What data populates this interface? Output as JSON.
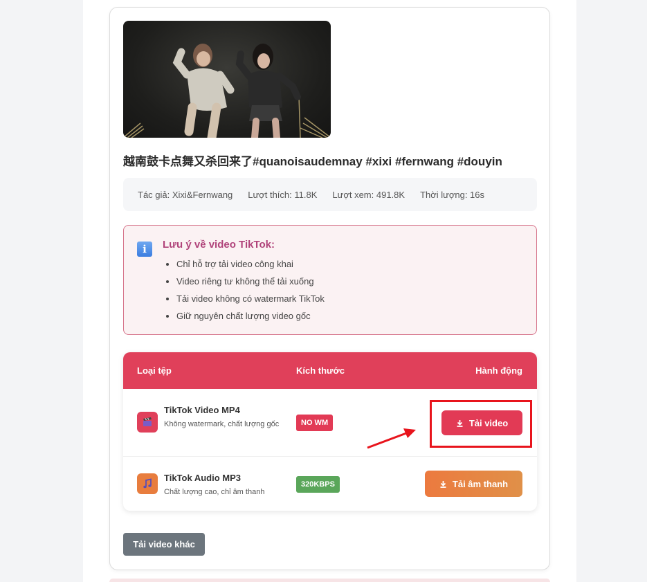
{
  "video": {
    "title": "越南鼓卡点舞又杀回来了#quanoisaudemnay #xixi #fernwang #douyin"
  },
  "meta": {
    "author": "Tác giả: Xixi&Fernwang",
    "likes": "Lượt thích: 11.8K",
    "views": "Lượt xem: 491.8K",
    "duration": "Thời lượng: 16s"
  },
  "note": {
    "title": "Lưu ý về video TikTok:",
    "items": [
      "Chỉ hỗ trợ tải video công khai",
      "Video riêng tư không thể tải xuống",
      "Tải video không có watermark TikTok",
      "Giữ nguyên chất lượng video gốc"
    ]
  },
  "table": {
    "headers": {
      "type": "Loại tệp",
      "size": "Kích thước",
      "action": "Hành động"
    },
    "rows": [
      {
        "name": "TikTok Video MP4",
        "desc": "Không watermark, chất lượng gốc",
        "badge": "NO WM",
        "button": "Tải video",
        "icon": "clapper-icon"
      },
      {
        "name": "TikTok Audio MP3",
        "desc": "Chất lượng cao, chỉ âm thanh",
        "badge": "320KBPS",
        "button": "Tải âm thanh",
        "icon": "music-note-icon"
      }
    ]
  },
  "other_button": "Tải video khác",
  "colors": {
    "accent": "#e0405a",
    "video_button": "#e23a55",
    "audio_button": "#e87d3e",
    "badge_wm": "#e23a55",
    "badge_audio": "#5aa65a",
    "note_title": "#b0437a",
    "highlight": "#e8141c",
    "secondary_button": "#6c757d"
  }
}
